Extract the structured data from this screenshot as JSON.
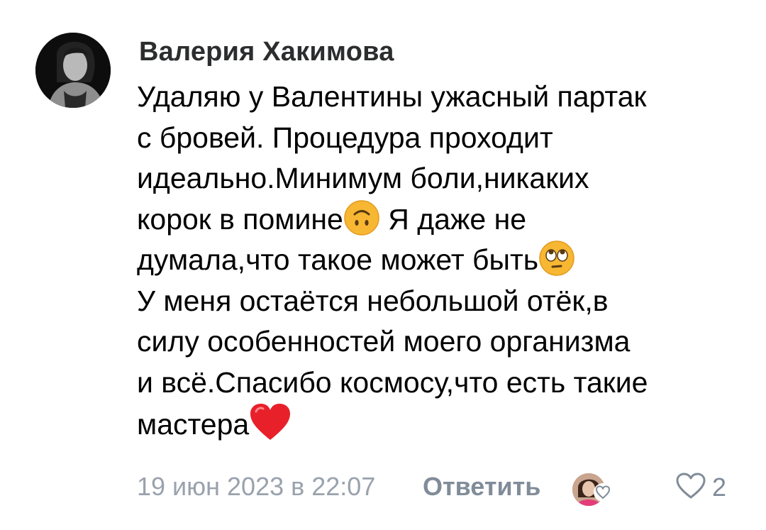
{
  "comment": {
    "author": "Валерия Хакимова",
    "lines": [
      "Удаляю у Валентины ужасный партак",
      "с бровей. Процедура проходит",
      "идеально.Минимум боли,никаких",
      "корок в помине",
      "Я даже не",
      "думала,что такое может быть",
      "У меня остаётся небольшой отёк,в",
      "силу особенностей моего организма",
      "и всё.Спасибо космосу,что есть такие",
      "мастера"
    ],
    "emojis": [
      "upside-down-face-emoji",
      "face-with-rolling-eyes-emoji",
      "red-heart-emoji"
    ]
  },
  "meta": {
    "date": "19 июн 2023 в 22:07",
    "reply_label": "Ответить",
    "like_count": "2"
  },
  "icons": {
    "avatar": "author-avatar",
    "liked_by": "liked-by-author-icon",
    "like": "heart-outline-icon"
  },
  "colors": {
    "author": "#2c2d2e",
    "meta": "#99a2ad",
    "reply": "#818c99",
    "emoji_yellow": "#f7b733",
    "heart_red": "#e8202a"
  }
}
